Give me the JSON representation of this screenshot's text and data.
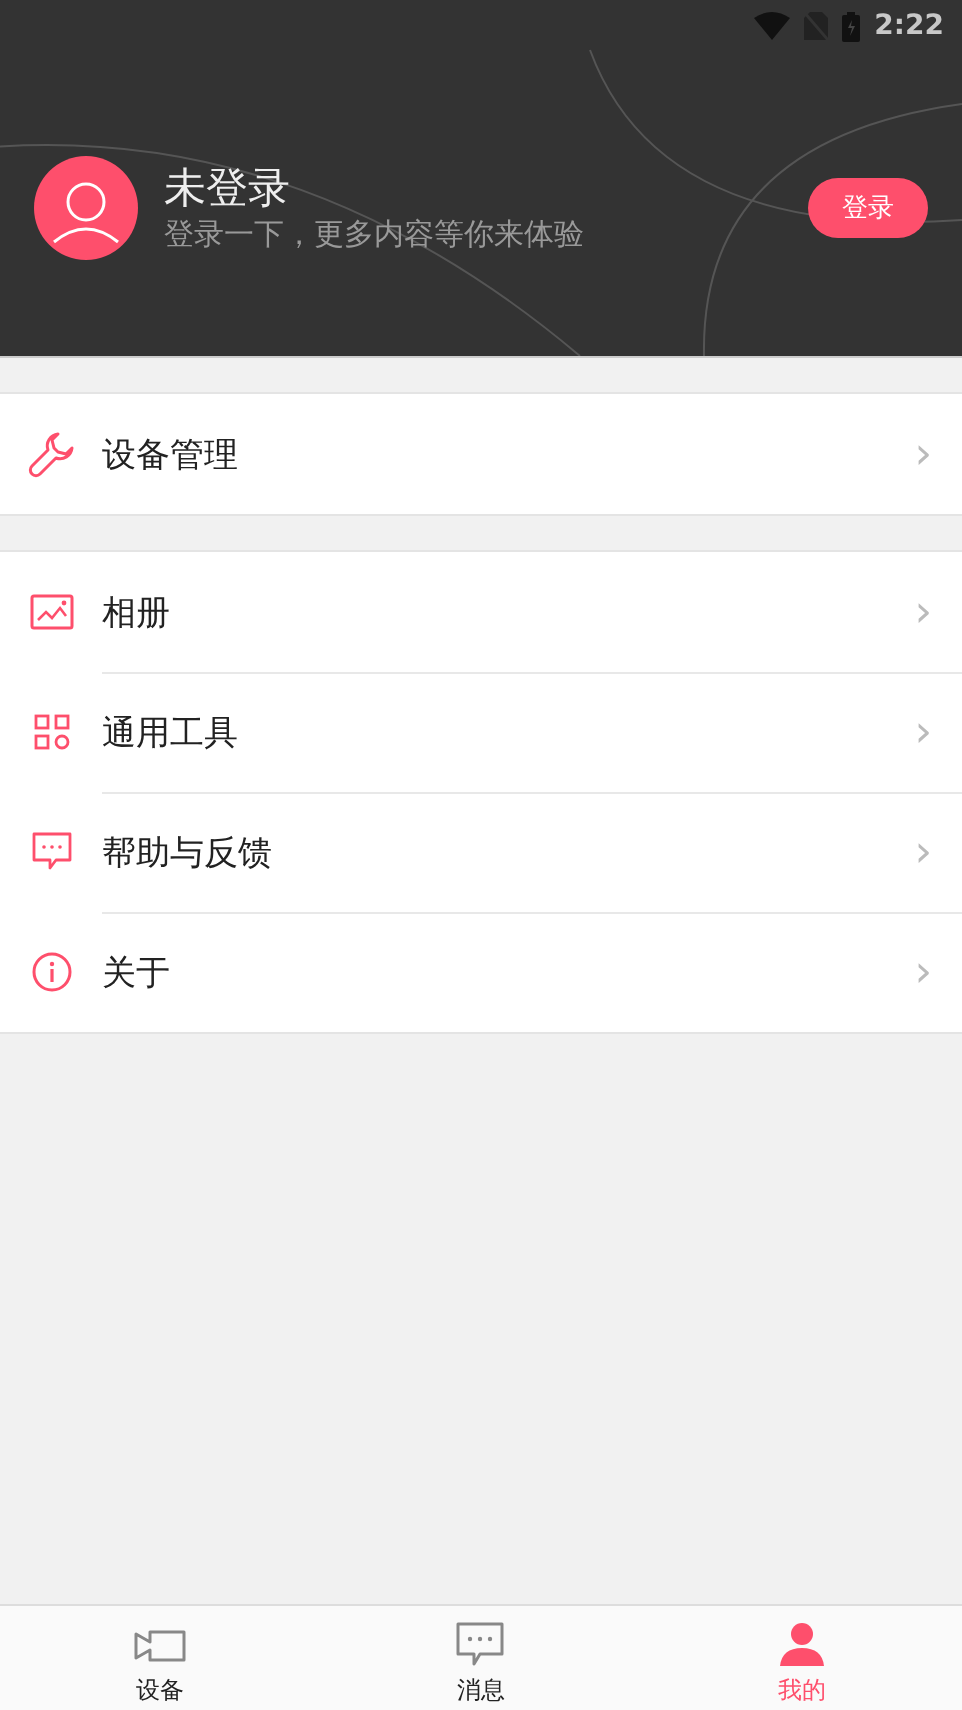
{
  "status_bar": {
    "time": "2:22"
  },
  "profile": {
    "name": "未登录",
    "subtitle": "登录一下，更多内容等你来体验",
    "login_button": "登录"
  },
  "menu_groups": [
    {
      "items": [
        {
          "label": "设备管理",
          "chevron": "›"
        }
      ]
    },
    {
      "items": [
        {
          "label": "相册",
          "chevron": "›"
        },
        {
          "label": "通用工具",
          "chevron": "›"
        },
        {
          "label": "帮助与反馈",
          "chevron": "›"
        },
        {
          "label": "关于",
          "chevron": "›"
        }
      ]
    }
  ],
  "tab_bar": [
    {
      "label": "设备",
      "selected": false
    },
    {
      "label": "消息",
      "selected": false
    },
    {
      "label": "我的",
      "selected": true
    }
  ]
}
